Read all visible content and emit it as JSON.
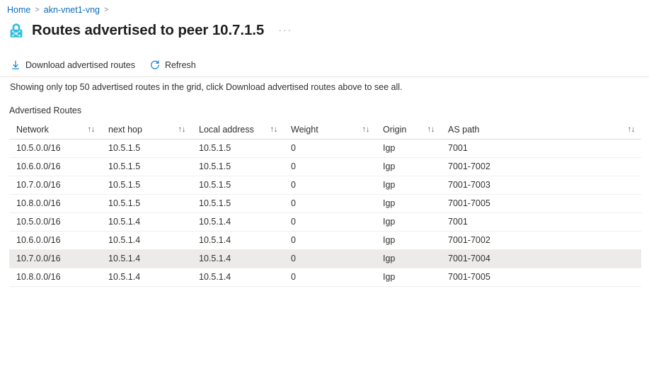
{
  "breadcrumb": {
    "items": [
      {
        "label": "Home",
        "icon": ""
      },
      {
        "label": "akn-vnet1-vng",
        "icon": ""
      }
    ],
    "separator": ">"
  },
  "header": {
    "icon": "vpn-gateway-lock-icon",
    "title": "Routes advertised to peer 10.7.1.5",
    "more_menu": "···"
  },
  "toolbar": {
    "download_label": "Download advertised routes",
    "download_icon": "download-icon",
    "refresh_label": "Refresh",
    "refresh_icon": "refresh-icon"
  },
  "notice": {
    "text": "Showing only top 50 advertised routes in the grid, click Download advertised routes above to see all."
  },
  "grid": {
    "label": "Advertised Routes",
    "sort_glyph": "↑↓",
    "columns": [
      {
        "key": "network",
        "label": "Network",
        "sortable": true
      },
      {
        "key": "next_hop",
        "label": "next hop",
        "sortable": true
      },
      {
        "key": "local_address",
        "label": "Local address",
        "sortable": true
      },
      {
        "key": "weight",
        "label": "Weight",
        "sortable": true
      },
      {
        "key": "origin",
        "label": "Origin",
        "sortable": true
      },
      {
        "key": "as_path",
        "label": "AS path",
        "sortable": true
      }
    ],
    "rows": [
      {
        "network": "10.5.0.0/16",
        "next_hop": "10.5.1.5",
        "local_address": "10.5.1.5",
        "weight": "0",
        "origin": "Igp",
        "as_path": "7001",
        "selected": false
      },
      {
        "network": "10.6.0.0/16",
        "next_hop": "10.5.1.5",
        "local_address": "10.5.1.5",
        "weight": "0",
        "origin": "Igp",
        "as_path": "7001-7002",
        "selected": false
      },
      {
        "network": "10.7.0.0/16",
        "next_hop": "10.5.1.5",
        "local_address": "10.5.1.5",
        "weight": "0",
        "origin": "Igp",
        "as_path": "7001-7003",
        "selected": false
      },
      {
        "network": "10.8.0.0/16",
        "next_hop": "10.5.1.5",
        "local_address": "10.5.1.5",
        "weight": "0",
        "origin": "Igp",
        "as_path": "7001-7005",
        "selected": false
      },
      {
        "network": "10.5.0.0/16",
        "next_hop": "10.5.1.4",
        "local_address": "10.5.1.4",
        "weight": "0",
        "origin": "Igp",
        "as_path": "7001",
        "selected": false
      },
      {
        "network": "10.6.0.0/16",
        "next_hop": "10.5.1.4",
        "local_address": "10.5.1.4",
        "weight": "0",
        "origin": "Igp",
        "as_path": "7001-7002",
        "selected": false
      },
      {
        "network": "10.7.0.0/16",
        "next_hop": "10.5.1.4",
        "local_address": "10.5.1.4",
        "weight": "0",
        "origin": "Igp",
        "as_path": "7001-7004",
        "selected": true
      },
      {
        "network": "10.8.0.0/16",
        "next_hop": "10.5.1.4",
        "local_address": "10.5.1.4",
        "weight": "0",
        "origin": "Igp",
        "as_path": "7001-7005",
        "selected": false
      }
    ]
  },
  "colors": {
    "link": "#0f6cbd",
    "text": "#323130",
    "title": "#201f1e",
    "icon_accent": "#32bedd",
    "icon_accent_dark": "#0078d4",
    "row_selected": "#edebe9",
    "border": "#e1dfdd",
    "background": "#ffffff"
  }
}
